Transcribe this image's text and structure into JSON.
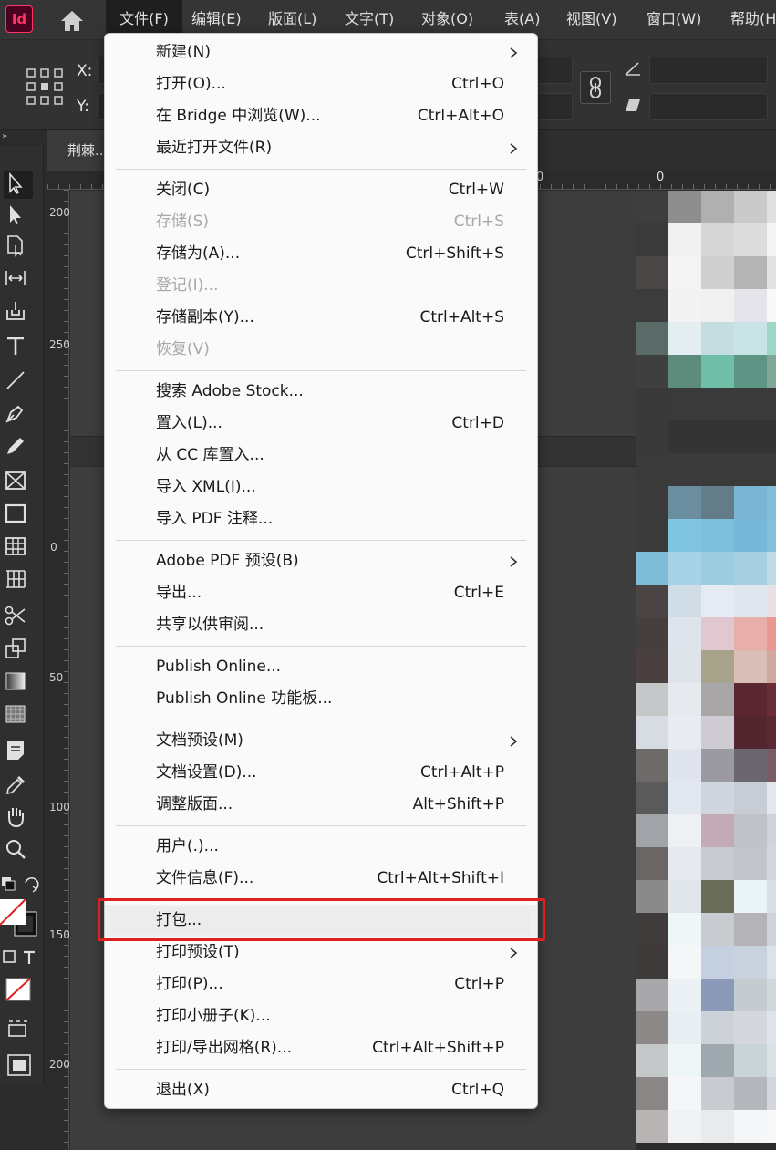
{
  "app": {
    "logo_text": "Id"
  },
  "menubar": {
    "items": [
      {
        "id": "file",
        "label": "文件(F)"
      },
      {
        "id": "edit",
        "label": "编辑(E)"
      },
      {
        "id": "layout",
        "label": "版面(L)"
      },
      {
        "id": "type",
        "label": "文字(T)"
      },
      {
        "id": "object",
        "label": "对象(O)"
      },
      {
        "id": "table",
        "label": "表(A)"
      },
      {
        "id": "view",
        "label": "视图(V)"
      },
      {
        "id": "window",
        "label": "窗口(W)"
      },
      {
        "id": "help",
        "label": "帮助(H"
      }
    ]
  },
  "controlbar": {
    "x_label": "X:",
    "y_label": "Y:"
  },
  "document_tab": {
    "title": "荆棘..."
  },
  "collapse_glyph": "»",
  "rulers": {
    "horizontal_zero": "0",
    "horizontal_zero_2": "0",
    "vertical": [
      {
        "text": "200"
      },
      {
        "text": "250"
      },
      {
        "text": "0"
      },
      {
        "text": "50"
      },
      {
        "text": "100"
      },
      {
        "text": "150"
      },
      {
        "text": "200"
      }
    ]
  },
  "file_menu": {
    "groups": [
      [
        {
          "label": "新建(N)",
          "shortcut": "",
          "submenu": true,
          "disabled": false
        },
        {
          "label": "打开(O)...",
          "shortcut": "Ctrl+O",
          "submenu": false,
          "disabled": false
        },
        {
          "label": "在 Bridge 中浏览(W)...",
          "shortcut": "Ctrl+Alt+O",
          "submenu": false,
          "disabled": false
        },
        {
          "label": "最近打开文件(R)",
          "shortcut": "",
          "submenu": true,
          "disabled": false
        }
      ],
      [
        {
          "label": "关闭(C)",
          "shortcut": "Ctrl+W",
          "submenu": false,
          "disabled": false
        },
        {
          "label": "存储(S)",
          "shortcut": "Ctrl+S",
          "submenu": false,
          "disabled": true
        },
        {
          "label": "存储为(A)...",
          "shortcut": "Ctrl+Shift+S",
          "submenu": false,
          "disabled": false
        },
        {
          "label": "登记(I)...",
          "shortcut": "",
          "submenu": false,
          "disabled": true
        },
        {
          "label": "存储副本(Y)...",
          "shortcut": "Ctrl+Alt+S",
          "submenu": false,
          "disabled": false
        },
        {
          "label": "恢复(V)",
          "shortcut": "",
          "submenu": false,
          "disabled": true
        }
      ],
      [
        {
          "label": "搜索 Adobe Stock...",
          "shortcut": "",
          "submenu": false,
          "disabled": false
        },
        {
          "label": "置入(L)...",
          "shortcut": "Ctrl+D",
          "submenu": false,
          "disabled": false
        },
        {
          "label": "从 CC 库置入...",
          "shortcut": "",
          "submenu": false,
          "disabled": false
        },
        {
          "label": "导入 XML(I)...",
          "shortcut": "",
          "submenu": false,
          "disabled": false
        },
        {
          "label": "导入 PDF 注释...",
          "shortcut": "",
          "submenu": false,
          "disabled": false
        }
      ],
      [
        {
          "label": "Adobe PDF 预设(B)",
          "shortcut": "",
          "submenu": true,
          "disabled": false
        },
        {
          "label": "导出...",
          "shortcut": "Ctrl+E",
          "submenu": false,
          "disabled": false
        },
        {
          "label": "共享以供审阅...",
          "shortcut": "",
          "submenu": false,
          "disabled": false
        }
      ],
      [
        {
          "label": "Publish Online...",
          "shortcut": "",
          "submenu": false,
          "disabled": false
        },
        {
          "label": "Publish Online 功能板...",
          "shortcut": "",
          "submenu": false,
          "disabled": false
        }
      ],
      [
        {
          "label": "文档预设(M)",
          "shortcut": "",
          "submenu": true,
          "disabled": false
        },
        {
          "label": "文档设置(D)...",
          "shortcut": "Ctrl+Alt+P",
          "submenu": false,
          "disabled": false
        },
        {
          "label": "调整版面...",
          "shortcut": "Alt+Shift+P",
          "submenu": false,
          "disabled": false
        }
      ],
      [
        {
          "label": "用户(.)...",
          "shortcut": "",
          "submenu": false,
          "disabled": false
        },
        {
          "label": "文件信息(F)...",
          "shortcut": "Ctrl+Alt+Shift+I",
          "submenu": false,
          "disabled": false
        }
      ],
      [
        {
          "label": "打包...",
          "shortcut": "",
          "submenu": false,
          "disabled": false,
          "hovered": true
        },
        {
          "label": "打印预设(T)",
          "shortcut": "",
          "submenu": true,
          "disabled": false
        },
        {
          "label": "打印(P)...",
          "shortcut": "Ctrl+P",
          "submenu": false,
          "disabled": false
        },
        {
          "label": "打印小册子(K)...",
          "shortcut": "",
          "submenu": false,
          "disabled": false
        },
        {
          "label": "打印/导出网格(R)...",
          "shortcut": "Ctrl+Alt+Shift+P",
          "submenu": false,
          "disabled": false
        }
      ],
      [
        {
          "label": "退出(X)",
          "shortcut": "Ctrl+Q",
          "submenu": false,
          "disabled": false
        }
      ]
    ]
  },
  "tools": [
    "selection-tool-icon",
    "direct-selection-tool-icon",
    "page-tool-icon",
    "gap-tool-icon",
    "content-collector-icon",
    "type-tool-icon",
    "line-tool-icon",
    "pen-tool-icon",
    "pencil-tool-icon",
    "rectangle-frame-tool-icon",
    "rectangle-tool-icon",
    "table-tool-icon",
    "table-column-tool-icon",
    "scissors-tool-icon",
    "free-transform-tool-icon",
    "gradient-swatch-tool-icon",
    "gradient-feather-tool-icon",
    "note-tool-icon",
    "eyedropper-tool-icon",
    "hand-tool-icon",
    "zoom-tool-icon"
  ],
  "colors": {
    "accent_logo": "#ff3366",
    "highlight_box": "#e02020",
    "menu_bg": "#fafafa"
  }
}
